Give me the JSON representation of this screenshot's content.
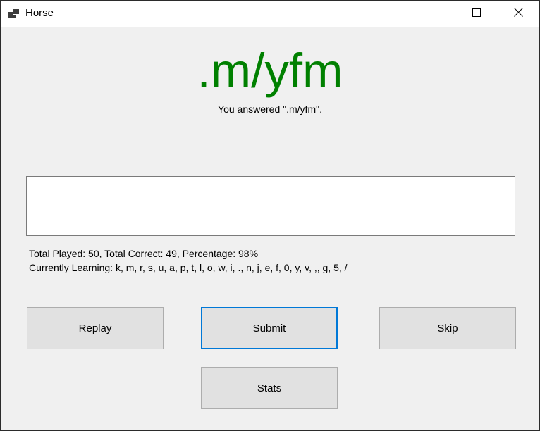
{
  "window": {
    "title": "Horse"
  },
  "icons": {
    "app": "app-icon",
    "minimize": "minimize-icon",
    "maximize": "maximize-icon",
    "close": "close-icon"
  },
  "main": {
    "answer_display": ".m/yfm",
    "answered_text": "You answered \".m/yfm\".",
    "input_value": "",
    "stats_line": "Total Played: 50, Total Correct: 49, Percentage: 98%",
    "learning_line": "Currently Learning: k, m, r, s, u, a, p, t, l, o, w, i, ., n, j, e, f, 0, y, v, ,, g, 5, /"
  },
  "buttons": {
    "replay": "Replay",
    "submit": "Submit",
    "skip": "Skip",
    "stats": "Stats"
  },
  "colors": {
    "answer_green": "#008000",
    "focus_blue": "#0078d7",
    "window_bg": "#f0f0f0",
    "button_bg": "#e1e1e1"
  }
}
